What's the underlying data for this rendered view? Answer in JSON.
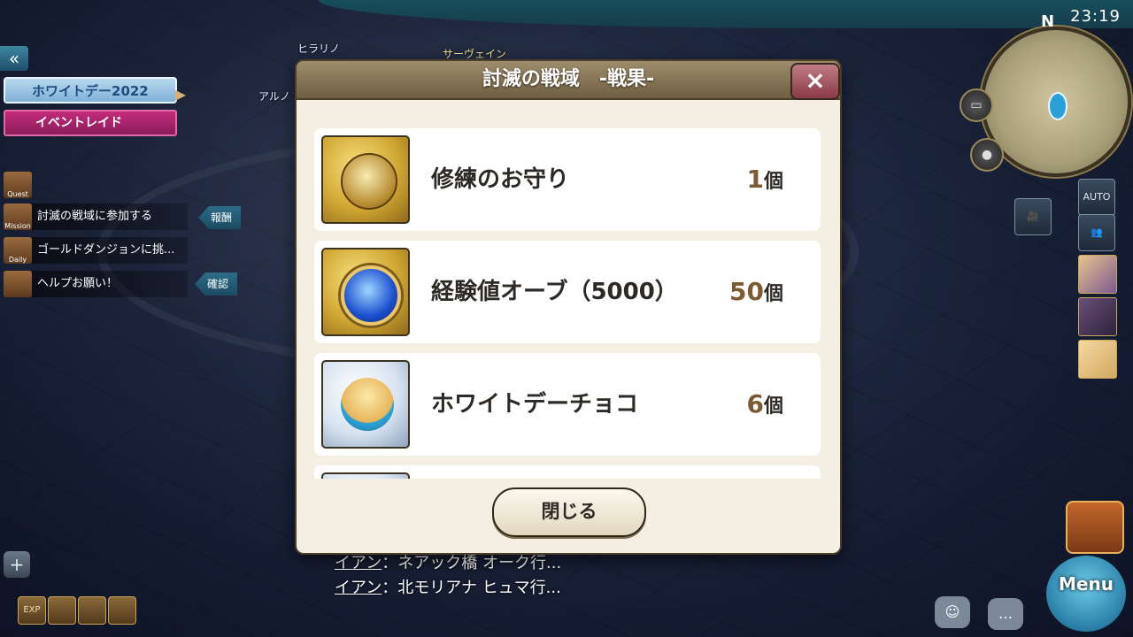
{
  "hud": {
    "clock": "23:19",
    "compass": "N",
    "event_tag": "ホワイトデー2022",
    "raid_tag": "イベントレイド",
    "side_tabs": [
      "Quest",
      "Mission",
      "Daily"
    ],
    "missions": [
      {
        "text": "討滅の戦域に参加する",
        "action": "報酬"
      },
      {
        "text": "ゴールドダンジョンに挑...",
        "action": ""
      },
      {
        "text": "ヘルプお願い！",
        "action": "確認"
      }
    ],
    "name_labels": [
      "ヒラリノ",
      "サーヴェイン",
      "アルノ"
    ],
    "exp_label": "EXP",
    "auto_label": "AUTO",
    "menu_label": "Menu"
  },
  "chat": [
    {
      "who": "イアン",
      "text": "：ネアック橋 オーク行..."
    },
    {
      "who": "イアン",
      "text": "：北モリアナ ヒュマ行..."
    }
  ],
  "modal": {
    "title": "討滅の戦域　-戦果-",
    "close_icon": "×",
    "items": [
      {
        "name": "修練のお守り",
        "qty": "1",
        "unit": "個",
        "icon": "amulet-icon"
      },
      {
        "name": "経験値オーブ（5000）",
        "qty": "50",
        "unit": "個",
        "icon": "exp-orb-icon"
      },
      {
        "name": "ホワイトデーチョコ",
        "qty": "6",
        "unit": "個",
        "icon": "white-day-choco-icon"
      }
    ],
    "close_button": "閉じる"
  }
}
